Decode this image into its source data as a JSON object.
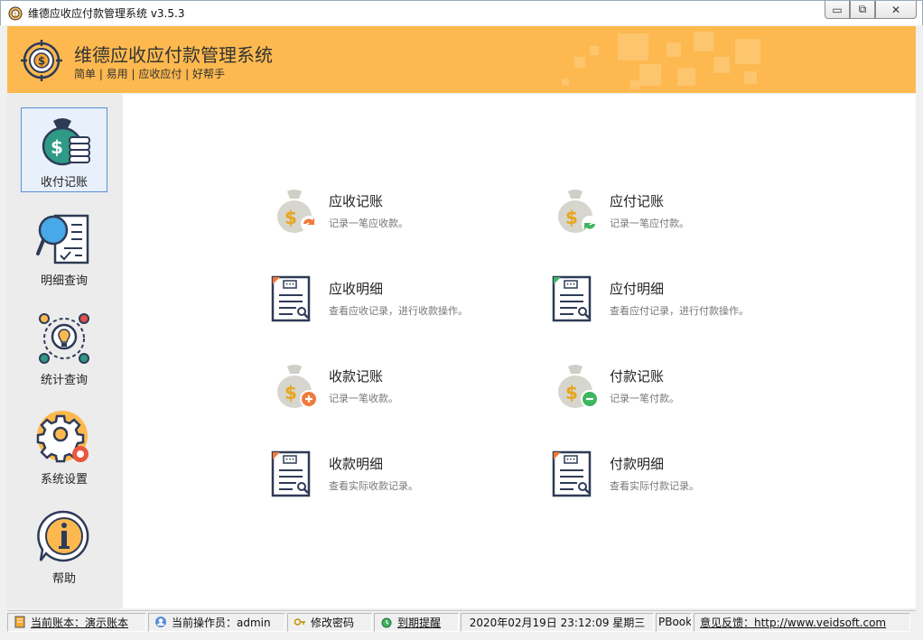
{
  "window": {
    "title": "维德应收应付款管理系统  v3.5.3",
    "min_glyph": "▭",
    "max_glyph": "⧉",
    "close_glyph": "✕"
  },
  "banner": {
    "app_name": "维德应收应付款管理系统",
    "slogan": "简单 | 易用 | 应收应付 | 好帮手"
  },
  "sidebar": {
    "items": [
      {
        "label": "收付记账",
        "icon": "money-bag-coins-icon",
        "active": true
      },
      {
        "label": "明细查询",
        "icon": "magnifier-document-icon"
      },
      {
        "label": "统计查询",
        "icon": "lightbulb-cycle-icon"
      },
      {
        "label": "系统设置",
        "icon": "gears-icon"
      },
      {
        "label": "帮助",
        "icon": "info-bubble-icon"
      }
    ]
  },
  "functions": [
    {
      "title": "应收记账",
      "desc": "记录一笔应收款。",
      "icon": "money-bag-arrow-icon"
    },
    {
      "title": "应付记账",
      "desc": "记录一笔应付款。",
      "icon": "money-bag-refresh-icon"
    },
    {
      "title": "应收明细",
      "desc": "查看应收记录，进行收款操作。",
      "icon": "document-search-icon"
    },
    {
      "title": "应付明细",
      "desc": "查看应付记录，进行付款操作。",
      "icon": "document-search-icon"
    },
    {
      "title": "收款记账",
      "desc": "记录一笔收款。",
      "icon": "money-bag-plus-icon"
    },
    {
      "title": "付款记账",
      "desc": "记录一笔付款。",
      "icon": "money-bag-minus-icon"
    },
    {
      "title": "收款明细",
      "desc": "查看实际收款记录。",
      "icon": "document-search-icon"
    },
    {
      "title": "付款明细",
      "desc": "查看实际付款记录。",
      "icon": "document-search-icon"
    }
  ],
  "status": {
    "account": "当前账本：演示账本",
    "operator": "当前操作员：admin",
    "change_password": "修改密码",
    "reminder": "到期提醒",
    "datetime": "2020年02月19日  23:12:09  星期三",
    "book_fragment": "PBook\\",
    "feedback": "意见反馈：http://www.veidsoft.com"
  },
  "colors": {
    "banner": "#fdb94f",
    "accent_orange": "#f07a3a",
    "accent_green": "#3fb560",
    "navy": "#2e3b57",
    "teal": "#2f9a86"
  }
}
